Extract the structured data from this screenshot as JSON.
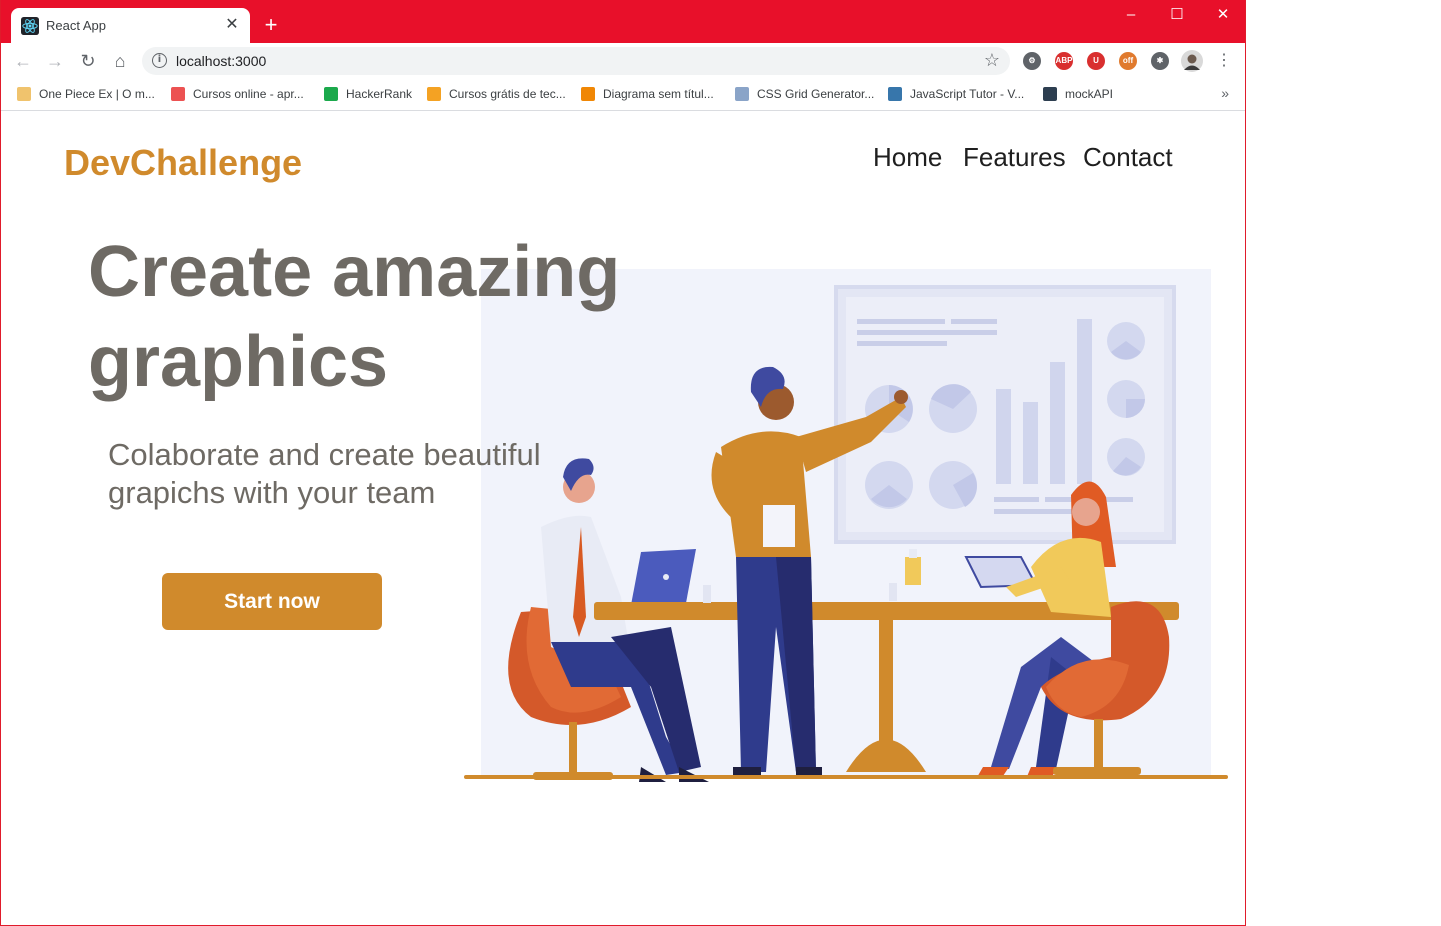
{
  "browser": {
    "tab_title": "React App",
    "tab_close": "✕",
    "new_tab": "+",
    "url": "localhost:3000",
    "window_controls": {
      "minimize": "–",
      "maximize": "☐",
      "close": "✕"
    }
  },
  "extensions": [
    {
      "name": "settings-extension",
      "label": "⚙",
      "color": "#5f6368"
    },
    {
      "name": "adblock-plus-extension",
      "label": "ABP",
      "color": "#d92f2f"
    },
    {
      "name": "ublock-extension",
      "label": "U",
      "color": "#d92f2f"
    },
    {
      "name": "off-extension",
      "label": "off",
      "color": "#e07a2e"
    },
    {
      "name": "puzzle-extension",
      "label": "✱",
      "color": "#5f6368"
    }
  ],
  "bookmarks": [
    {
      "label": "One Piece Ex | O m...",
      "color": "#f0c36d"
    },
    {
      "label": "Cursos online - apr...",
      "color": "#ec5252"
    },
    {
      "label": "HackerRank",
      "color": "#1ba94c"
    },
    {
      "label": "Cursos grátis de tec...",
      "color": "#f4a223"
    },
    {
      "label": "Diagrama sem títul...",
      "color": "#f08705"
    },
    {
      "label": "CSS Grid Generator...",
      "color": "#8aa4c8"
    },
    {
      "label": "JavaScript Tutor - V...",
      "color": "#3776ab"
    },
    {
      "label": "mockAPI",
      "color": "#2d3e50"
    }
  ],
  "bookmarks_more": "»",
  "page": {
    "logo": "DevChallenge",
    "nav": [
      "Home",
      "Features",
      "Contact"
    ],
    "hero_title": "Create amazing graphics",
    "hero_subtitle": "Colaborate and create beautiful grapichs with your team",
    "cta_label": "Start now"
  },
  "colors": {
    "accent": "#d08a2c",
    "text": "#6e6a64",
    "chrome": "#e8102a"
  }
}
